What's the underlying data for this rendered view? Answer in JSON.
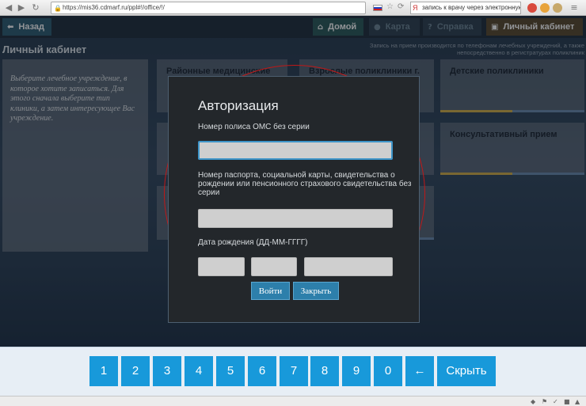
{
  "browser": {
    "url": "https://mis36.cdmarf.ru/ppl#!/office/!/",
    "search_text": "запись к врачу через электронную"
  },
  "topbar": {
    "back_label": "Назад",
    "home_label": "Домой",
    "map_label": "Карта",
    "help_label": "Справка",
    "cabinet_label": "Личный кабинет"
  },
  "notice": "Запись на прием производится по телефонам лечебных учреждений, а также непосредственно в регистратурах поликлиник",
  "page_title": "Личный кабинет",
  "info_text": "Выберите лечебное учреждение, в которое хотите записаться. Для этого сначала выберите тип клиники, а затем интересующее Вас учреждение.",
  "cards": [
    {
      "title": "Районные медицинские"
    },
    {
      "title": "Взрослые поликлиники г."
    },
    {
      "title": "Детские поликлиники"
    },
    {
      "title": "Консультативный прием"
    }
  ],
  "modal": {
    "title": "Авторизация",
    "oms_label": "Номер полиса ОМС без серии",
    "passport_label": "Номер паспорта, социальной карты, свидетельства о рождении или пенсионного страхового свидетельства без серии",
    "birth_label": "Дата рождения (ДД-ММ-ГГГГ)",
    "login_label": "Войти",
    "close_label": "Закрыть"
  },
  "keypad": [
    "1",
    "2",
    "3",
    "4",
    "5",
    "6",
    "7",
    "8",
    "9",
    "0",
    "←",
    "Скрыть"
  ],
  "icons": {
    "back": "arrow-left-icon",
    "home": "home-icon",
    "map": "map-icon",
    "help": "question-icon",
    "cabinet": "user-icon"
  },
  "colors": {
    "keypad_key": "#1899da",
    "modal_button": "#2d7fab",
    "focus_border": "#3e95c9",
    "annotation_circle": "#c01818"
  }
}
